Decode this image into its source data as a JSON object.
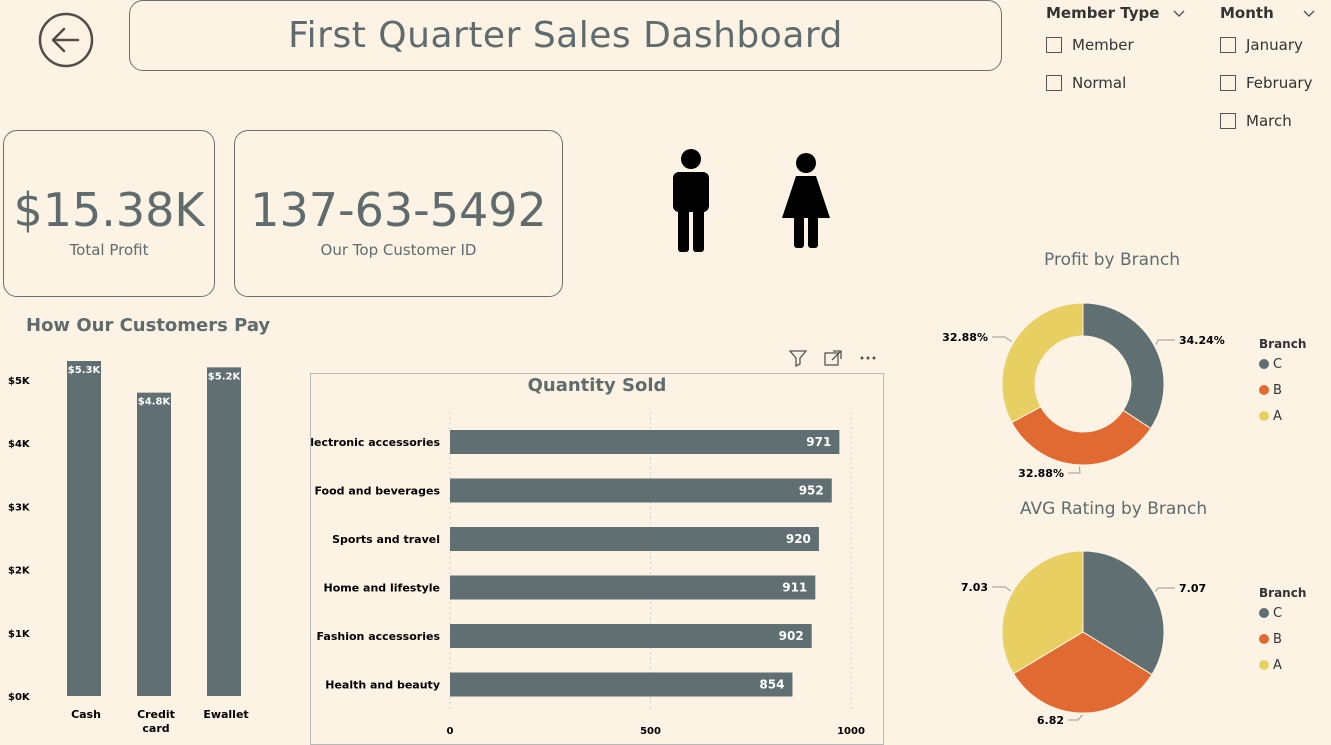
{
  "header": {
    "title": "First Quarter Sales Dashboard"
  },
  "slicers": {
    "member_type": {
      "title": "Member Type",
      "options": [
        "Member",
        "Normal"
      ]
    },
    "month": {
      "title": "Month",
      "options": [
        "January",
        "February",
        "March"
      ]
    }
  },
  "cards": {
    "profit": {
      "value": "$15.38K",
      "label": "Total Profit"
    },
    "customer": {
      "value": "137-63-5492",
      "label": "Our Top Customer ID"
    }
  },
  "icons": {
    "male": "male-person-icon",
    "female": "female-person-icon",
    "back": "arrow-left-circle-icon"
  },
  "colors": {
    "bar": "#5f6f72",
    "C": "#5f6f72",
    "B": "#e06a32",
    "A": "#e7cf62",
    "background": "#fcf3e4"
  },
  "payment": {
    "title": "How Our Customers Pay",
    "ticks": [
      "$5K",
      "$4K",
      "$3K",
      "$2K",
      "$1K",
      "$0K"
    ]
  },
  "quantity": {
    "title": "Quantity Sold",
    "ticks": [
      "0",
      "500",
      "1000"
    ],
    "toolbar": [
      "filter-icon",
      "focus-mode-icon",
      "more-options-icon"
    ]
  },
  "profit_by_branch": {
    "title": "Profit by Branch",
    "legend_title": "Branch",
    "legend": [
      "C",
      "B",
      "A"
    ]
  },
  "rating_by_branch": {
    "title": "AVG Rating by Branch",
    "legend_title": "Branch",
    "legend": [
      "C",
      "B",
      "A"
    ]
  },
  "chart_data": [
    {
      "type": "bar",
      "title": "How Our Customers Pay",
      "categories": [
        "Cash",
        "Credit card",
        "Ewallet"
      ],
      "values": [
        5.3,
        4.8,
        5.2
      ],
      "data_labels": [
        "$5.3K",
        "$4.8K",
        "$5.2K"
      ],
      "unit": "$K",
      "ylim": [
        0,
        5.5
      ]
    },
    {
      "type": "bar",
      "orientation": "horizontal",
      "title": "Quantity Sold",
      "categories": [
        "Electronic accessories",
        "Food and beverages",
        "Sports and travel",
        "Home and lifestyle",
        "Fashion accessories",
        "Health and beauty"
      ],
      "values": [
        971,
        952,
        920,
        911,
        902,
        854
      ],
      "xlim": [
        0,
        1000
      ]
    },
    {
      "type": "pie",
      "subtype": "donut",
      "title": "Profit by Branch",
      "categories": [
        "C",
        "B",
        "A"
      ],
      "values": [
        34.24,
        32.88,
        32.88
      ],
      "data_labels": [
        "34.24%",
        "32.88%",
        "32.88%"
      ]
    },
    {
      "type": "pie",
      "title": "AVG Rating by Branch",
      "categories": [
        "C",
        "B",
        "A"
      ],
      "values": [
        7.07,
        6.82,
        7.03
      ],
      "data_labels": [
        "7.07",
        "6.82",
        "7.03"
      ]
    }
  ]
}
